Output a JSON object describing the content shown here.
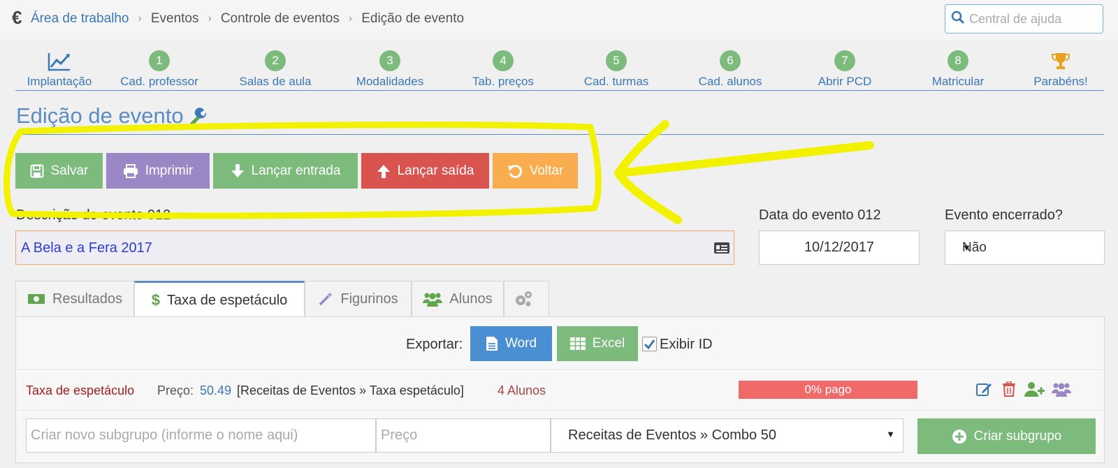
{
  "breadcrumb": {
    "items": [
      "Área de trabalho",
      "Eventos",
      "Controle de eventos",
      "Edição de evento"
    ]
  },
  "help": {
    "placeholder": "Central de ajuda"
  },
  "steps": [
    {
      "num": "",
      "label": "Implantação",
      "icon": "chart-line-icon"
    },
    {
      "num": "1",
      "label": "Cad. professor"
    },
    {
      "num": "2",
      "label": "Salas de aula"
    },
    {
      "num": "3",
      "label": "Modalidades"
    },
    {
      "num": "4",
      "label": "Tab. preços"
    },
    {
      "num": "5",
      "label": "Cad. turmas"
    },
    {
      "num": "6",
      "label": "Cad. alunos"
    },
    {
      "num": "7",
      "label": "Abrir PCD"
    },
    {
      "num": "8",
      "label": "Matricular"
    },
    {
      "num": "",
      "label": "Parabéns!",
      "icon": "trophy-icon"
    }
  ],
  "page": {
    "title": "Edição de evento"
  },
  "actions": {
    "save": "Salvar",
    "print": "Imprimir",
    "entry": "Lançar entrada",
    "exit": "Lançar saída",
    "back": "Voltar"
  },
  "form": {
    "desc_label": "Descrição do evento 012",
    "desc_value": "A Bela e a Fera 2017",
    "date_label": "Data do evento 012",
    "date_value": "10/12/2017",
    "closed_label": "Evento encerrado?",
    "closed_value": "Não"
  },
  "tabs": [
    {
      "label": "Resultados"
    },
    {
      "label": "Taxa de espetáculo"
    },
    {
      "label": "Figurinos"
    },
    {
      "label": "Alunos"
    },
    {
      "label": ""
    }
  ],
  "export": {
    "label": "Exportar:",
    "word": "Word",
    "excel": "Excel",
    "show_id": "Exibir ID",
    "show_id_checked": true
  },
  "fee": {
    "name": "Taxa de espetáculo",
    "price_label": "Preço:",
    "price": "50.49",
    "account": "[Receitas de Eventos » Taxa espetáculo]",
    "students": "4 Alunos",
    "paid_text": "0% pago",
    "paid_fraction": 0
  },
  "subgroup": {
    "name_placeholder": "Criar novo subgrupo (informe o nome aqui)",
    "price_placeholder": "Preço",
    "account": "Receitas de Eventos » Combo 50",
    "create": "Criar subgrupo"
  },
  "colors": {
    "green": "#7dbb7d",
    "purple": "#9b87c6",
    "red": "#d9534f",
    "orange": "#f9ad4e",
    "blue": "#4a8fd1",
    "link": "#3a78b5",
    "annotation": "#f2f200"
  }
}
